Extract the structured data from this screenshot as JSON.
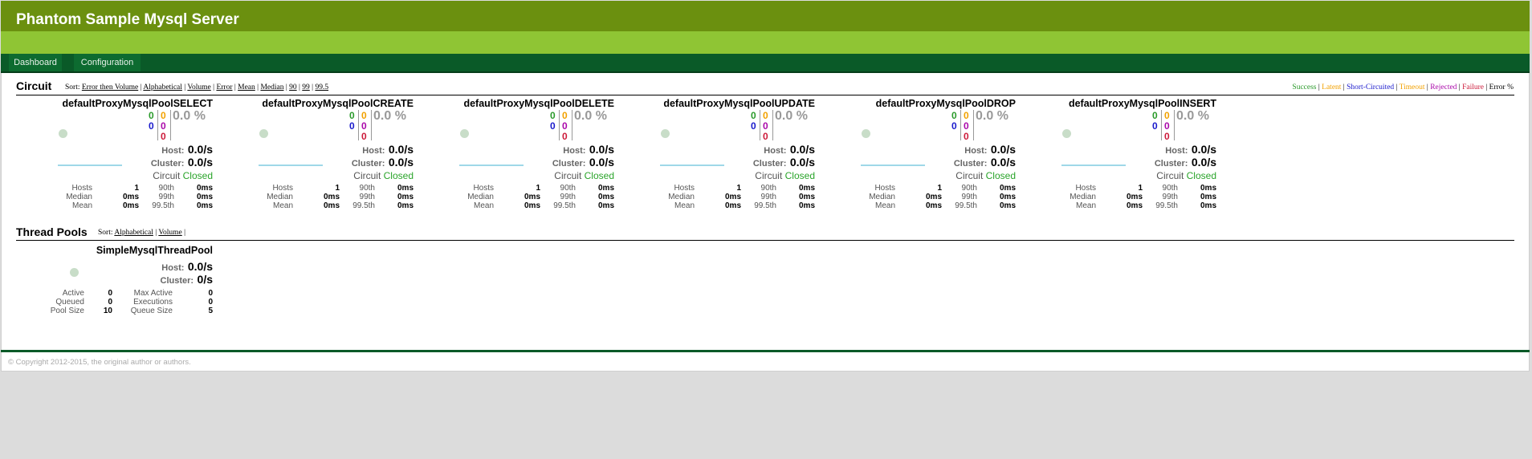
{
  "app": {
    "title": "Phantom Sample Mysql Server"
  },
  "nav": [
    {
      "label": "Dashboard",
      "active": true
    },
    {
      "label": "Configuration",
      "active": true
    }
  ],
  "circuit_section": {
    "title": "Circuit",
    "sort_prefix": "Sort:",
    "sort_options": [
      "Error then Volume",
      "Alphabetical",
      "Volume",
      "Error",
      "Mean",
      "Median",
      "90",
      "99",
      "99.5"
    ]
  },
  "legend": {
    "items": [
      {
        "label": "Success",
        "color": "#2a9a2a"
      },
      {
        "label": "Latent",
        "color": "#f2a100"
      },
      {
        "label": "Short-Circuited",
        "color": "#1a1acc"
      },
      {
        "label": "Timeout",
        "color": "#f2a100"
      },
      {
        "label": "Rejected",
        "color": "#aa0aaa"
      },
      {
        "label": "Failure",
        "color": "#cc1a3a"
      },
      {
        "label": "Error %",
        "color": "#000000"
      }
    ]
  },
  "count_colors": {
    "success": "#2a9a2a",
    "short_circuited": "#1a1acc",
    "timeout": "#f2a100",
    "rejected": "#aa0aaa",
    "failure": "#cc1a3a"
  },
  "labels": {
    "host": "Host:",
    "cluster": "Cluster:",
    "circuit": "Circuit",
    "hosts": "Hosts",
    "median": "Median",
    "mean": "Mean",
    "p90": "90th",
    "p99": "99th",
    "p995": "99.5th"
  },
  "circuits": [
    {
      "name": "defaultProxyMysqlPoolSELECT",
      "success": "0",
      "short_circuited": "0",
      "timeout": "0",
      "rejected": "0",
      "failure": "0",
      "error_pct": "0.0 %",
      "host_rate": "0.0/s",
      "cluster_rate": "0.0/s",
      "status": "Closed",
      "hosts": "1",
      "median": "0ms",
      "mean": "0ms",
      "p90": "0ms",
      "p99": "0ms",
      "p995": "0ms"
    },
    {
      "name": "defaultProxyMysqlPoolCREATE",
      "success": "0",
      "short_circuited": "0",
      "timeout": "0",
      "rejected": "0",
      "failure": "0",
      "error_pct": "0.0 %",
      "host_rate": "0.0/s",
      "cluster_rate": "0.0/s",
      "status": "Closed",
      "hosts": "1",
      "median": "0ms",
      "mean": "0ms",
      "p90": "0ms",
      "p99": "0ms",
      "p995": "0ms"
    },
    {
      "name": "defaultProxyMysqlPoolDELETE",
      "success": "0",
      "short_circuited": "0",
      "timeout": "0",
      "rejected": "0",
      "failure": "0",
      "error_pct": "0.0 %",
      "host_rate": "0.0/s",
      "cluster_rate": "0.0/s",
      "status": "Closed",
      "hosts": "1",
      "median": "0ms",
      "mean": "0ms",
      "p90": "0ms",
      "p99": "0ms",
      "p995": "0ms"
    },
    {
      "name": "defaultProxyMysqlPoolUPDATE",
      "success": "0",
      "short_circuited": "0",
      "timeout": "0",
      "rejected": "0",
      "failure": "0",
      "error_pct": "0.0 %",
      "host_rate": "0.0/s",
      "cluster_rate": "0.0/s",
      "status": "Closed",
      "hosts": "1",
      "median": "0ms",
      "mean": "0ms",
      "p90": "0ms",
      "p99": "0ms",
      "p995": "0ms"
    },
    {
      "name": "defaultProxyMysqlPoolDROP",
      "success": "0",
      "short_circuited": "0",
      "timeout": "0",
      "rejected": "0",
      "failure": "0",
      "error_pct": "0.0 %",
      "host_rate": "0.0/s",
      "cluster_rate": "0.0/s",
      "status": "Closed",
      "hosts": "1",
      "median": "0ms",
      "mean": "0ms",
      "p90": "0ms",
      "p99": "0ms",
      "p995": "0ms"
    },
    {
      "name": "defaultProxyMysqlPoolINSERT",
      "success": "0",
      "short_circuited": "0",
      "timeout": "0",
      "rejected": "0",
      "failure": "0",
      "error_pct": "0.0 %",
      "host_rate": "0.0/s",
      "cluster_rate": "0.0/s",
      "status": "Closed",
      "hosts": "1",
      "median": "0ms",
      "mean": "0ms",
      "p90": "0ms",
      "p99": "0ms",
      "p995": "0ms"
    }
  ],
  "thread_section": {
    "title": "Thread Pools",
    "sort_prefix": "Sort:",
    "sort_options": [
      "Alphabetical",
      "Volume"
    ]
  },
  "thread_pool": {
    "name": "SimpleMysqlThreadPool",
    "host_rate": "0.0/s",
    "cluster_rate": "0/s",
    "labels": {
      "active": "Active",
      "queued": "Queued",
      "pool_size": "Pool Size",
      "max_active": "Max Active",
      "executions": "Executions",
      "queue_size": "Queue Size"
    },
    "active": "0",
    "queued": "0",
    "pool_size": "10",
    "max_active": "0",
    "executions": "0",
    "queue_size": "5"
  },
  "footer": {
    "text": "© Copyright 2012-2015, the original author or authors."
  }
}
